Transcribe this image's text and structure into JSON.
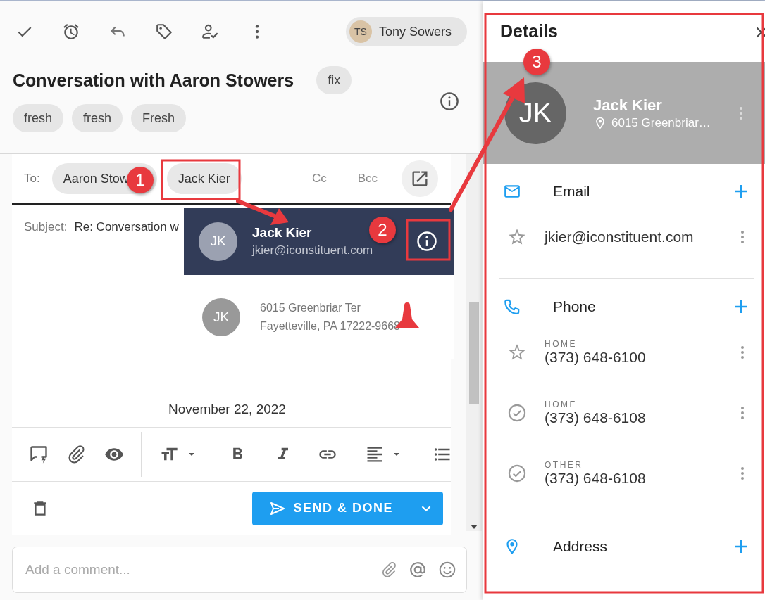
{
  "toolbar": {
    "user_chip": {
      "initials": "TS",
      "name": "Tony Sowers"
    }
  },
  "conversation": {
    "title": "Conversation with Aaron Stowers",
    "tags": [
      {
        "label": "fix"
      },
      {
        "label": "fresh"
      },
      {
        "label": "fresh"
      },
      {
        "label": "Fresh"
      }
    ]
  },
  "compose": {
    "to_label": "To:",
    "recipients": [
      {
        "name": "Aaron Stow"
      },
      {
        "name": "Jack Kier"
      }
    ],
    "cc": "Cc",
    "bcc": "Bcc",
    "subject_label": "Subject:",
    "subject": "Re: Conversation w",
    "date": "November 22, 2022",
    "send_button": "SEND & DONE"
  },
  "contact_popup": {
    "initials": "JK",
    "name": "Jack Kier",
    "email": "jkier@iconstituent.com",
    "address_initials": "JK",
    "address_lines": [
      "6015 Greenbriar Ter",
      "Fayetteville, PA 17222-9668"
    ]
  },
  "comment": {
    "placeholder": "Add a comment..."
  },
  "details": {
    "title": "Details",
    "initials": "JK",
    "name": "Jack Kier",
    "address": "6015 Greenbriar…",
    "sections": [
      {
        "kind": "email",
        "title": "Email",
        "entries": [
          {
            "primary": true,
            "value": "jkier@iconstituent.com"
          }
        ]
      },
      {
        "kind": "phone",
        "title": "Phone",
        "entries": [
          {
            "primary": true,
            "type": "HOME",
            "value": "(373) 648-6100"
          },
          {
            "primary": false,
            "type": "HOME",
            "value": "(373) 648-6108"
          },
          {
            "primary": false,
            "type": "OTHER",
            "value": "(373) 648-6108"
          }
        ]
      },
      {
        "kind": "address",
        "title": "Address"
      }
    ]
  },
  "annotations": [
    {
      "label": "1"
    },
    {
      "label": "2"
    },
    {
      "label": "3"
    }
  ]
}
